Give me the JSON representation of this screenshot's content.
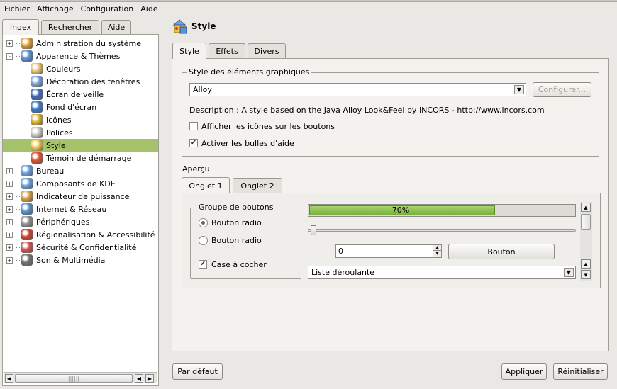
{
  "menu": [
    "Fichier",
    "Affichage",
    "Configuration",
    "Aide"
  ],
  "left_tabs": [
    "Index",
    "Rechercher",
    "Aide"
  ],
  "tree": [
    {
      "label": "Administration du système",
      "level": 0,
      "expander": "+",
      "icon": "admin-icon"
    },
    {
      "label": "Apparence & Thèmes",
      "level": 0,
      "expander": "-",
      "icon": "appearance-icon"
    },
    {
      "label": "Couleurs",
      "level": 1,
      "icon": "colors-icon"
    },
    {
      "label": "Décoration des fenêtres",
      "level": 1,
      "icon": "window-decoration-icon"
    },
    {
      "label": "Écran de veille",
      "level": 1,
      "icon": "screensaver-icon"
    },
    {
      "label": "Fond d'écran",
      "level": 1,
      "icon": "wallpaper-icon"
    },
    {
      "label": "Icônes",
      "level": 1,
      "icon": "icons-icon"
    },
    {
      "label": "Polices",
      "level": 1,
      "icon": "fonts-icon"
    },
    {
      "label": "Style",
      "level": 1,
      "icon": "style-icon",
      "selected": true
    },
    {
      "label": "Témoin de démarrage",
      "level": 1,
      "icon": "splash-icon"
    },
    {
      "label": "Bureau",
      "level": 0,
      "expander": "+",
      "icon": "desktop-icon"
    },
    {
      "label": "Composants de KDE",
      "level": 0,
      "expander": "+",
      "icon": "kde-components-icon"
    },
    {
      "label": "Indicateur de puissance",
      "level": 0,
      "expander": "+",
      "icon": "power-icon"
    },
    {
      "label": "Internet & Réseau",
      "level": 0,
      "expander": "+",
      "icon": "network-icon"
    },
    {
      "label": "Périphériques",
      "level": 0,
      "expander": "+",
      "icon": "peripherals-icon"
    },
    {
      "label": "Régionalisation & Accessibilité",
      "level": 0,
      "expander": "+",
      "icon": "regional-icon"
    },
    {
      "label": "Sécurité & Confidentialité",
      "level": 0,
      "expander": "+",
      "icon": "security-icon"
    },
    {
      "label": "Son & Multimédia",
      "level": 0,
      "expander": "+",
      "icon": "sound-icon"
    }
  ],
  "page_title": "Style",
  "main_tabs": [
    "Style",
    "Effets",
    "Divers"
  ],
  "widget_group": {
    "title": "Style des éléments graphiques",
    "combo_value": "Alloy",
    "configure_label": "Configurer...",
    "description": "Description : A style based on the Java Alloy Look&Feel by INCORS - http://www.incors.com",
    "show_icons_label": "Afficher les icônes sur les boutons",
    "show_icons_checked": false,
    "tooltips_label": "Activer les bulles d'aide",
    "tooltips_checked": true
  },
  "preview": {
    "title": "Aperçu",
    "tabs": [
      "Onglet 1",
      "Onglet 2"
    ],
    "group_title": "Groupe de boutons",
    "radio1": "Bouton radio",
    "radio2": "Bouton radio",
    "checkbox": "Case à cocher",
    "progress_text": "70%",
    "progress_value": 0.7,
    "spin_value": "0",
    "button_label": "Bouton",
    "dropdown_value": "Liste déroulante"
  },
  "footer": {
    "defaults": "Par défaut",
    "apply": "Appliquer",
    "reset": "Réinitialiser"
  },
  "colors": {
    "selection": "#a6c26a",
    "progress": "#8dbf55"
  }
}
